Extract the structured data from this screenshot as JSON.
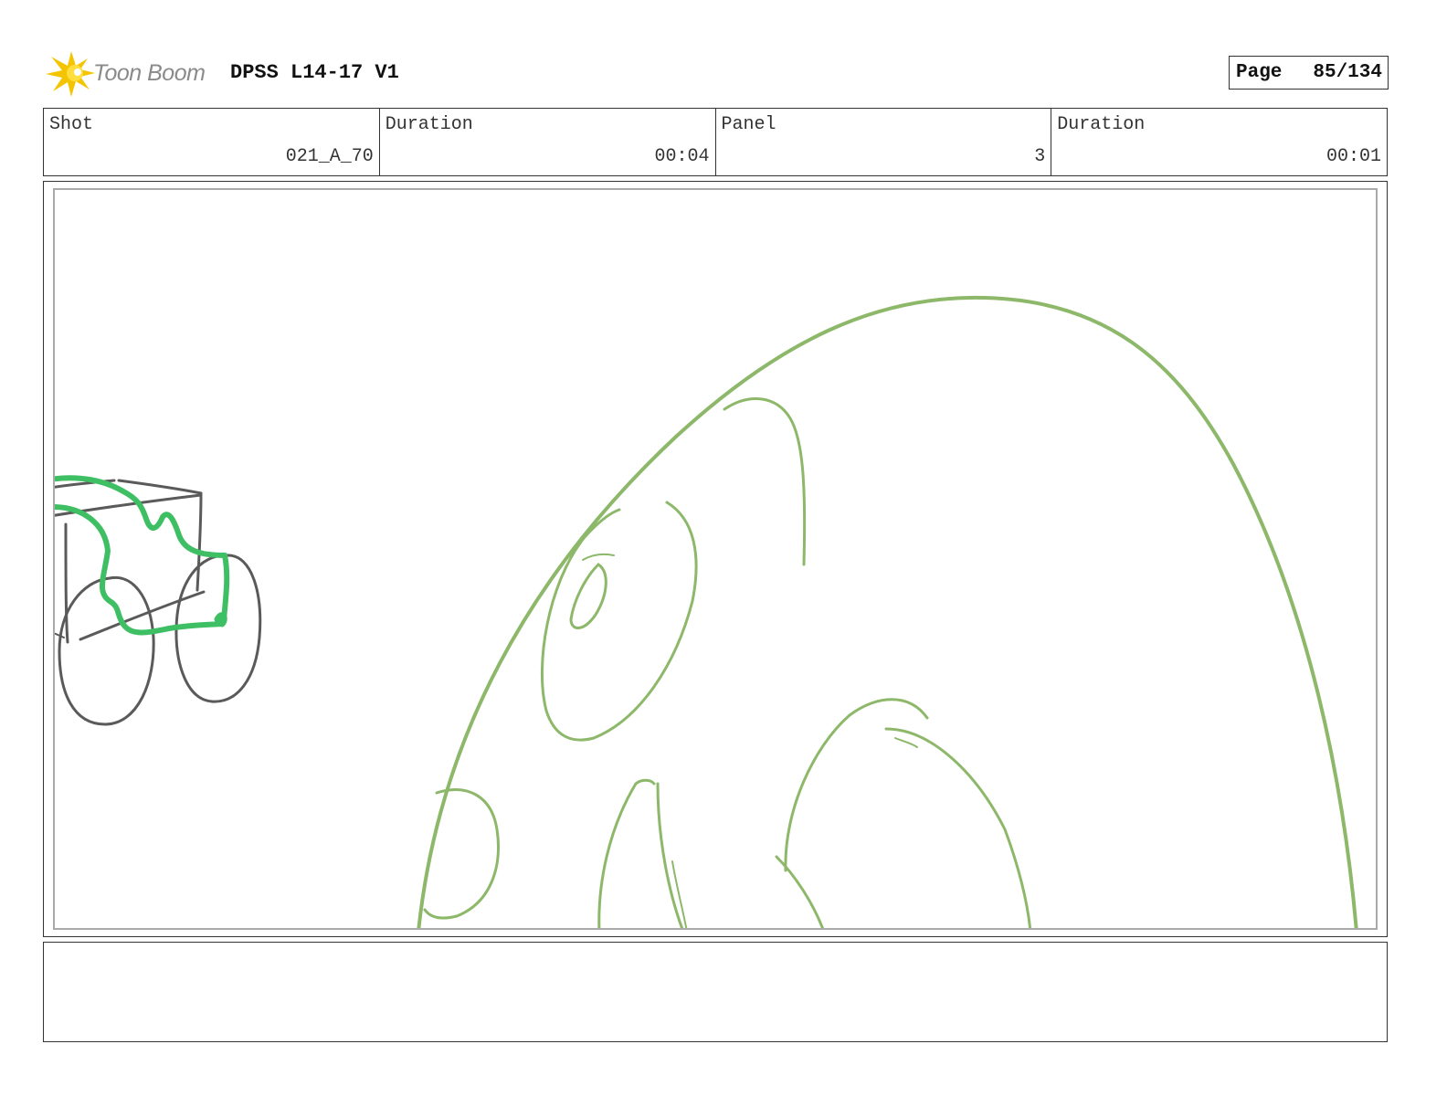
{
  "header": {
    "brand": "Toon Boom",
    "title": "DPSS L14-17 V1",
    "page_label": "Page",
    "page_value": "85/134"
  },
  "info": {
    "shot_label": "Shot",
    "shot_value": "021_A_70",
    "shot_duration_label": "Duration",
    "shot_duration_value": "00:04",
    "panel_label": "Panel",
    "panel_value": "3",
    "panel_duration_label": "Duration",
    "panel_duration_value": "00:01"
  },
  "colors": {
    "sketch_green": "#8db86a",
    "wagon_gray": "#5a5a5a",
    "wagon_green": "#3fbf63",
    "logo_yellow": "#f5c400"
  },
  "icons": [
    "toon-boom-logo-icon"
  ]
}
